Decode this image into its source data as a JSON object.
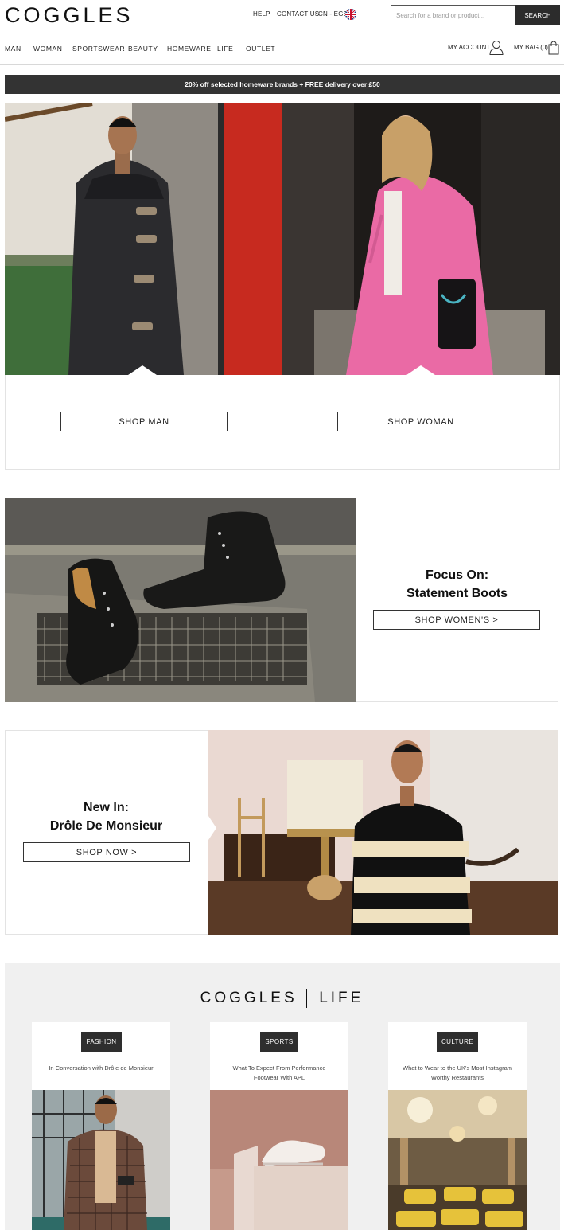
{
  "header": {
    "logo": "COGGLES",
    "util_links": {
      "help": "HELP",
      "contact": "CONTACT US",
      "locale": "CN - EGBP"
    },
    "search": {
      "placeholder": "Search for a brand or product...",
      "button": "SEARCH"
    },
    "account": "MY ACCOUNT",
    "bag": "MY BAG (0)"
  },
  "nav": [
    "MAN",
    "WOMAN",
    "SPORTSWEAR",
    "BEAUTY",
    "HOMEWARE",
    "LIFE",
    "OUTLET"
  ],
  "promo": "20% off selected homeware brands + FREE delivery over £50",
  "hero": {
    "shop_man": "SHOP MAN",
    "shop_woman": "SHOP WOMAN"
  },
  "feature_boots": {
    "line1": "Focus On:",
    "line2": "Statement Boots",
    "cta": "SHOP WOMEN'S >"
  },
  "feature_drole": {
    "line1": "New In:",
    "line2": "Drôle De Monsieur",
    "cta": "SHOP NOW >"
  },
  "life": {
    "logo_left": "COGGLES",
    "logo_right": "LIFE",
    "cards": [
      {
        "tag": "FASHION",
        "title": "In Conversation with Drôle de Monsieur"
      },
      {
        "tag": "SPORTS",
        "title": "What To Expect From Performance Footwear With APL"
      },
      {
        "tag": "CULTURE",
        "title": "What to Wear to the UK's Most Instagram Worthy Restaurants"
      }
    ]
  }
}
